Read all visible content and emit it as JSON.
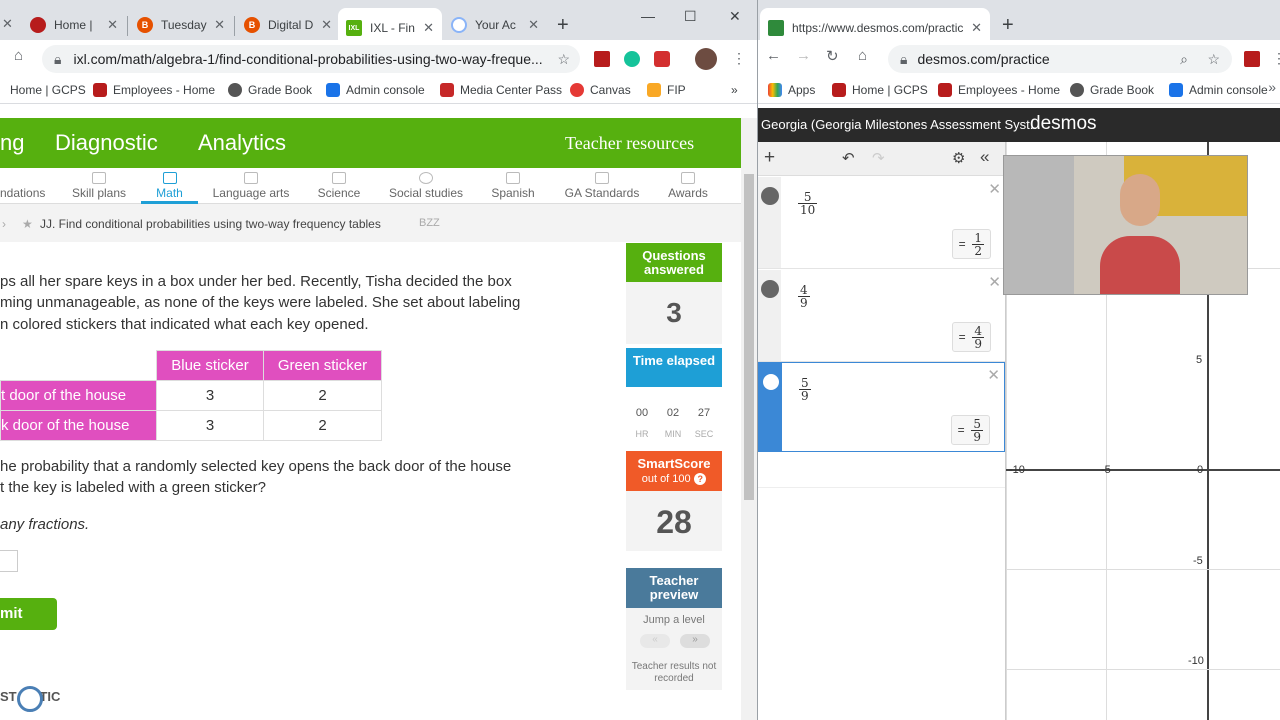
{
  "left_browser": {
    "tabs": [
      {
        "label": "Home |",
        "color": "#b71c1c"
      },
      {
        "label": "Tuesday",
        "color": "#e65100"
      },
      {
        "label": "Digital D",
        "color": "#e65100"
      },
      {
        "label": "IXL - Fin",
        "color": "#56b00f"
      },
      {
        "label": "Your Ac",
        "color": "#5f6368"
      }
    ],
    "url": "ixl.com/math/algebra-1/find-conditional-probabilities-using-two-way-freque...",
    "bookmarks": [
      "Home | GCPS",
      "Employees - Home",
      "Grade Book",
      "Admin console",
      "Media Center Pass",
      "Canvas",
      "FIP"
    ],
    "bookmark_more": "»"
  },
  "ixl": {
    "nav": [
      "ng",
      "Diagnostic",
      "Analytics",
      "Teacher resources"
    ],
    "subnav": [
      "ndations",
      "Skill plans",
      "Math",
      "Language arts",
      "Science",
      "Social studies",
      "Spanish",
      "GA Standards",
      "Awards"
    ],
    "breadcrumb": "JJ. Find conditional probabilities using two-way frequency tables",
    "skill_code": "BZZ",
    "question_lines": [
      "ps all her spare keys in a box under her bed. Recently, Tisha decided the box",
      "ming unmanageable, as none of the keys were labeled. She set about labeling",
      "n colored stickers that indicated what each key opened."
    ],
    "table": {
      "headers": [
        "Blue sticker",
        "Green sticker"
      ],
      "rows": [
        {
          "label": "t door of the house",
          "values": [
            "3",
            "2"
          ]
        },
        {
          "label": "k door of the house",
          "values": [
            "3",
            "2"
          ]
        }
      ]
    },
    "prompt_lines": [
      "he probability that a randomly selected key opens the back door of the house",
      "t the key is labeled with a green sticker?"
    ],
    "hint": "any fractions.",
    "submit": "mit",
    "sidebar": {
      "questions_label": "Questions answered",
      "questions_value": "3",
      "time_label": "Time elapsed",
      "time": [
        "00",
        "02",
        "27"
      ],
      "time_units": [
        "HR",
        "MIN",
        "SEC"
      ],
      "smartscore_label": "SmartScore",
      "smartscore_sub": "out of 100",
      "smartscore_value": "28",
      "teacher_preview": "Teacher preview",
      "jump": "Jump a level",
      "not_recorded": "Teacher results not recorded"
    },
    "watermark": "ST MATIC"
  },
  "right_browser": {
    "tab_label": "https://www.desmos.com/practic",
    "url": "desmos.com/practice",
    "bookmarks": [
      "Apps",
      "Home | GCPS",
      "Employees - Home",
      "Grade Book",
      "Admin console"
    ]
  },
  "desmos": {
    "title": "Georgia (Georgia Milestones Assessment Syst...",
    "logo": "desmos",
    "expressions": [
      {
        "n": "5",
        "d": "10",
        "rn": "1",
        "rd": "2"
      },
      {
        "n": "4",
        "d": "9",
        "rn": "4",
        "rd": "9"
      },
      {
        "n": "5",
        "d": "9",
        "rn": "5",
        "rd": "9"
      }
    ],
    "axis_x": [
      "-10",
      "-5",
      "0"
    ],
    "axis_y": [
      "5",
      "-5",
      "-10"
    ]
  }
}
